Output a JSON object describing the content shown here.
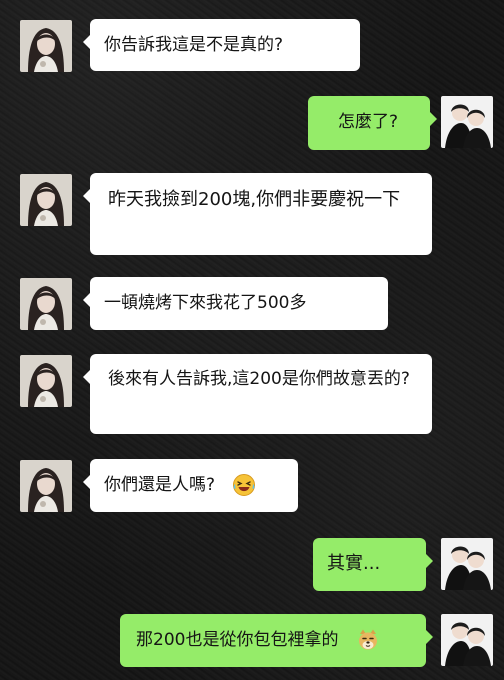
{
  "chat": {
    "messages": [
      {
        "side": "in",
        "text": "你告訴我這是不是真的?"
      },
      {
        "side": "out",
        "text": "怎麼了?"
      },
      {
        "side": "in",
        "text": "昨天我撿到200塊,你們非要慶祝一下"
      },
      {
        "side": "in",
        "text": "一頓燒烤下來我花了500多"
      },
      {
        "side": "in",
        "text": "後來有人告訴我,這200是你們故意丟的?"
      },
      {
        "side": "in",
        "text": "你們還是人嗎?",
        "emoji": "laughing-tears-emoji"
      },
      {
        "side": "out",
        "text": "其實..."
      },
      {
        "side": "out",
        "text": "那200也是從你包包裡拿的",
        "emoji": "doge-emoji"
      }
    ],
    "colors": {
      "incoming_bubble": "#ffffff",
      "outgoing_bubble": "#95ec69",
      "background": "#151515"
    }
  }
}
